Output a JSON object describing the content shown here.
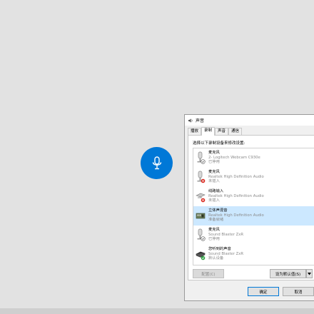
{
  "dialog": {
    "title": "声音",
    "tabs": [
      "播放",
      "录制",
      "声音",
      "通信"
    ],
    "active_tab": 1,
    "instruction": "选择以下录制设备来修改设置:",
    "devices": [
      {
        "name": "麦克风",
        "detail": "2- Logitech Webcam C930e",
        "status": "已停用",
        "icon": "microphone-disabled-icon"
      },
      {
        "name": "麦克风",
        "detail": "Realtek High Definition Audio",
        "status": "未插入",
        "icon": "microphone-unplugged-icon"
      },
      {
        "name": "线路输入",
        "detail": "Realtek High Definition Audio",
        "status": "未插入",
        "icon": "line-in-unplugged-icon"
      },
      {
        "name": "立体声混音",
        "detail": "Realtek High Definition Audio",
        "status": "准备就绪",
        "icon": "stereo-mix-icon"
      },
      {
        "name": "麦克风",
        "detail": "Sound Blaster ZxR",
        "status": "已停用",
        "icon": "microphone-disabled-icon"
      },
      {
        "name": "您听到的声音",
        "detail": "Sound Blaster ZxR",
        "status": "默认设备",
        "icon": "what-u-hear-default-icon"
      }
    ],
    "selected_index": 3,
    "configure_label": "配置(C)",
    "set_default_label": "设为默认值(S)",
    "ok_label": "确定",
    "cancel_label": "取消"
  },
  "colors": {
    "accent": "#0078d7",
    "selection": "#cce8ff",
    "background": "#e2e2e2"
  }
}
